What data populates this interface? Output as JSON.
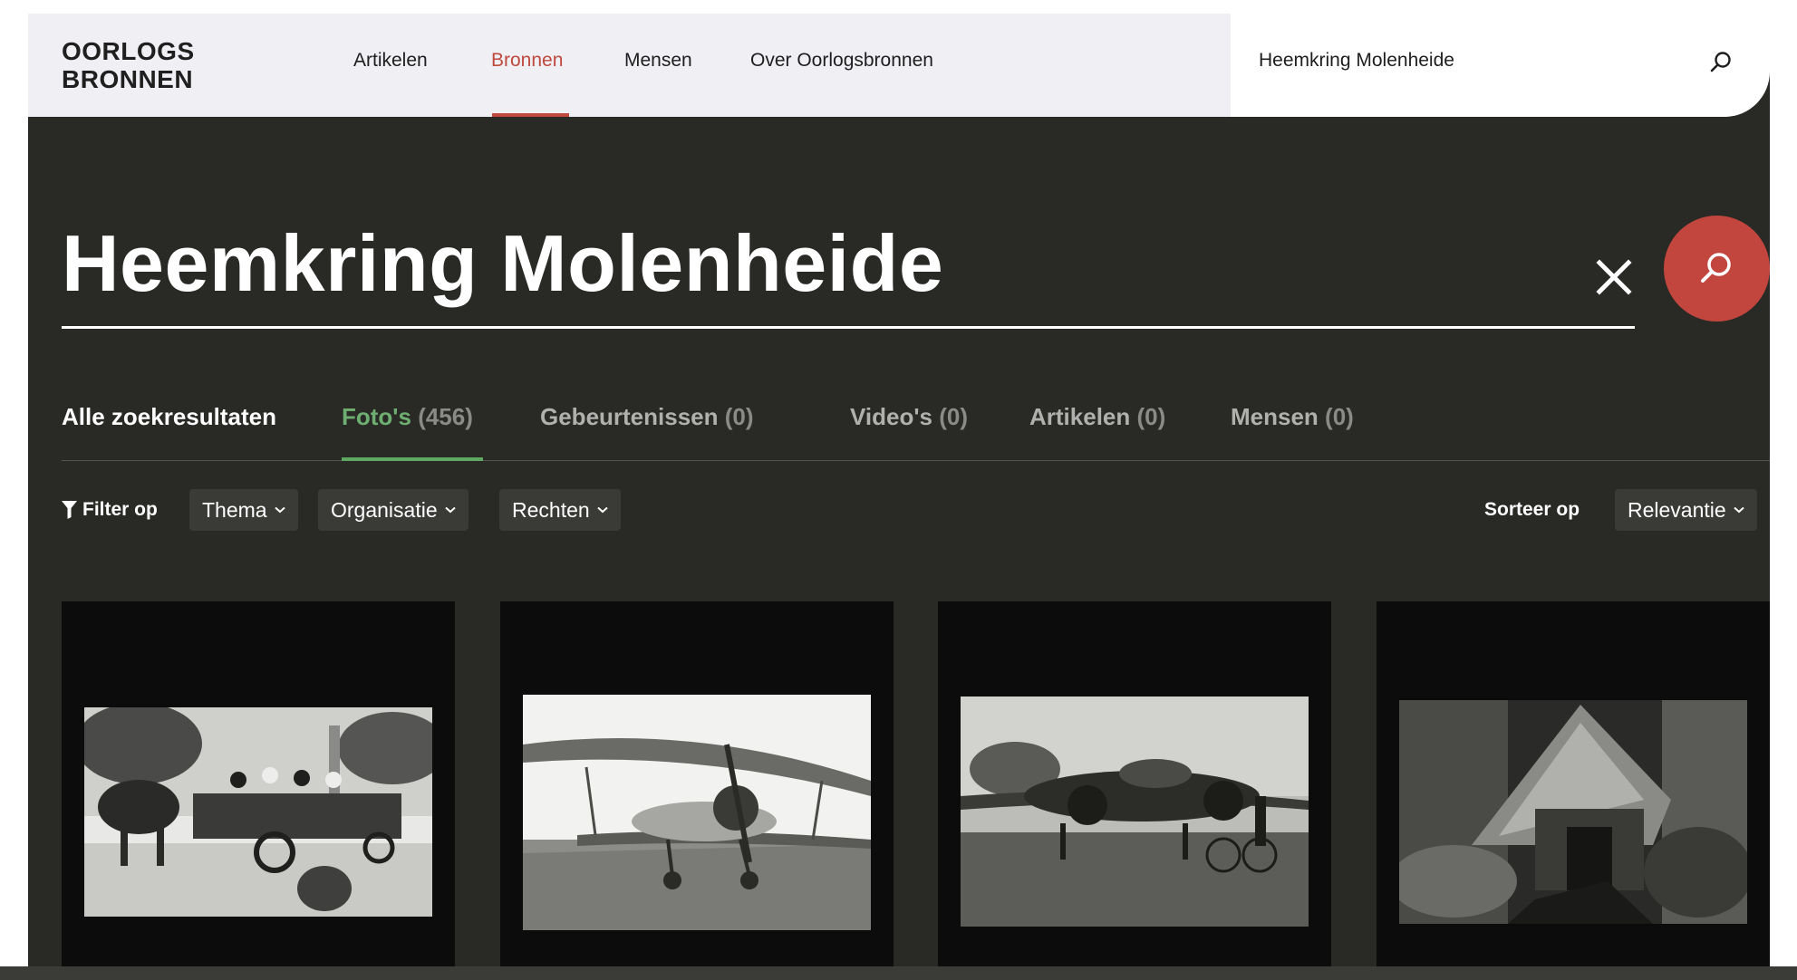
{
  "logo": {
    "line1": "OORLOGS",
    "line2": "BRONNEN"
  },
  "nav": {
    "items": [
      {
        "label": "Artikelen"
      },
      {
        "label": "Bronnen"
      },
      {
        "label": "Mensen"
      },
      {
        "label": "Over Oorlogsbronnen"
      }
    ],
    "active": "Bronnen"
  },
  "header_search": {
    "value": "Heemkring Molenheide",
    "icon": "search-icon"
  },
  "search": {
    "query": "Heemkring Molenheide",
    "clear_icon": "close-icon",
    "submit_icon": "search-icon"
  },
  "tabs": [
    {
      "label": "Alle zoekresultaten",
      "count": ""
    },
    {
      "label": "Foto's",
      "count": "(456)"
    },
    {
      "label": "Gebeurtenissen",
      "count": "(0)"
    },
    {
      "label": "Video's",
      "count": "(0)"
    },
    {
      "label": "Artikelen",
      "count": "(0)"
    },
    {
      "label": "Mensen",
      "count": "(0)"
    }
  ],
  "active_tab": "Foto's",
  "filters": {
    "label": "Filter op",
    "icon": "filter-icon",
    "options": [
      {
        "label": "Thema"
      },
      {
        "label": "Organisatie"
      },
      {
        "label": "Rechten"
      }
    ]
  },
  "sort": {
    "label": "Sorteer op",
    "value": "Relevantie"
  },
  "results": [
    {
      "photo": "horse-drawn-wagon-photo"
    },
    {
      "photo": "biplane-photo"
    },
    {
      "photo": "twin-engine-plane-photo"
    },
    {
      "photo": "thatched-hut-photo"
    }
  ],
  "colors": {
    "accent_red": "#c2463e",
    "active_tab_green": "#6fae71",
    "background_dark": "#292a26",
    "nav_background": "#efeff4"
  }
}
